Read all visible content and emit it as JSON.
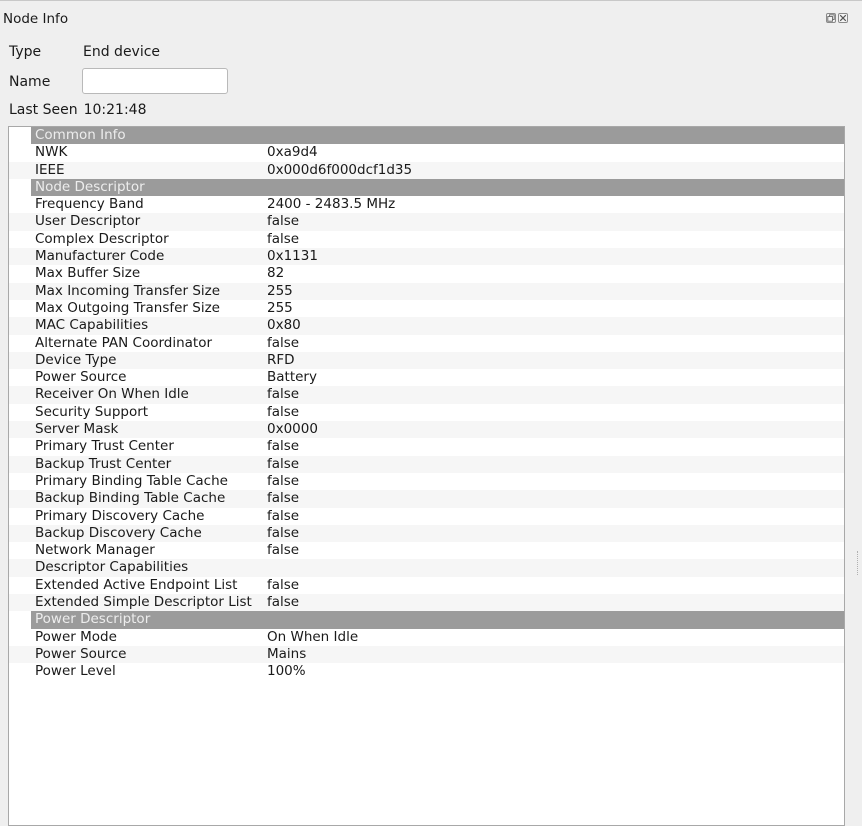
{
  "window": {
    "title": "Node Info"
  },
  "fields": {
    "type_label": "Type",
    "type_value": "End device",
    "name_label": "Name",
    "name_value": "",
    "last_seen_label": "Last Seen",
    "last_seen_value": "10:21:48"
  },
  "icons": {
    "float": "float-icon",
    "close": "close-icon"
  },
  "sections": [
    {
      "title": "Common Info",
      "rows": [
        {
          "key": "NWK",
          "value": "0xa9d4"
        },
        {
          "key": "IEEE",
          "value": "0x000d6f000dcf1d35"
        }
      ]
    },
    {
      "title": "Node Descriptor",
      "rows": [
        {
          "key": "Frequency Band",
          "value": "2400 - 2483.5 MHz"
        },
        {
          "key": "User Descriptor",
          "value": "false"
        },
        {
          "key": "Complex Descriptor",
          "value": "false"
        },
        {
          "key": "Manufacturer Code",
          "value": "0x1131"
        },
        {
          "key": "Max Buffer Size",
          "value": "82"
        },
        {
          "key": "Max Incoming Transfer Size",
          "value": "255"
        },
        {
          "key": "Max Outgoing Transfer Size",
          "value": "255"
        },
        {
          "key": "MAC Capabilities",
          "value": "0x80"
        },
        {
          "key": "Alternate PAN Coordinator",
          "value": "false"
        },
        {
          "key": "Device Type",
          "value": "RFD"
        },
        {
          "key": "Power Source",
          "value": "Battery"
        },
        {
          "key": "Receiver On When Idle",
          "value": "false"
        },
        {
          "key": "Security Support",
          "value": "false"
        },
        {
          "key": "Server Mask",
          "value": "0x0000"
        },
        {
          "key": "Primary Trust Center",
          "value": "false"
        },
        {
          "key": "Backup Trust Center",
          "value": "false"
        },
        {
          "key": "Primary Binding Table Cache",
          "value": "false"
        },
        {
          "key": "Backup Binding Table Cache",
          "value": "false"
        },
        {
          "key": "Primary Discovery Cache",
          "value": "false"
        },
        {
          "key": "Backup Discovery Cache",
          "value": "false"
        },
        {
          "key": "Network Manager",
          "value": "false"
        },
        {
          "key": "Descriptor Capabilities",
          "value": ""
        },
        {
          "key": "Extended Active Endpoint List",
          "value": "false"
        },
        {
          "key": "Extended Simple Descriptor List",
          "value": "false"
        }
      ]
    },
    {
      "title": "Power Descriptor",
      "rows": [
        {
          "key": "Power Mode",
          "value": "On When Idle"
        },
        {
          "key": "Power Source",
          "value": "Mains"
        },
        {
          "key": "Power Level",
          "value": "100%"
        }
      ]
    }
  ],
  "colors": {
    "section_header": "#9b9b9b",
    "section_text": "#ededed",
    "alt_row": "#f6f6f6",
    "background": "#efefef"
  }
}
